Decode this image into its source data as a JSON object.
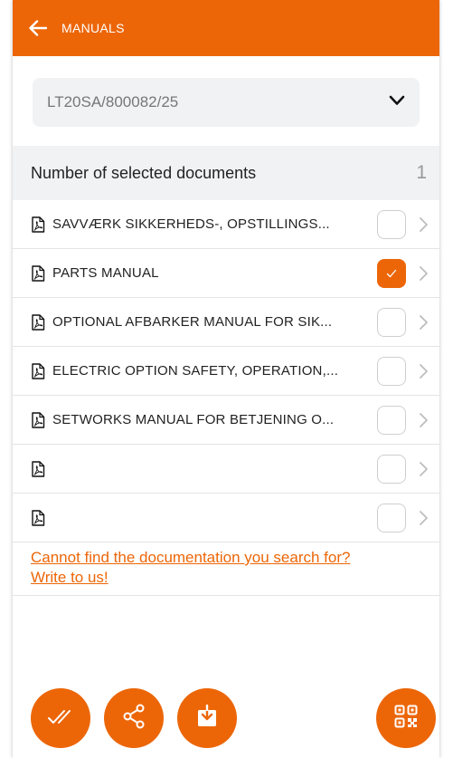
{
  "header": {
    "title": "MANUALS",
    "back_icon": "arrow-left-icon"
  },
  "machine_select": {
    "value": "LT20SA/800082/25",
    "icon": "chevron-down-icon"
  },
  "selection": {
    "label": "Number of selected documents",
    "count": "1"
  },
  "documents": [
    {
      "name": "SAVVÆRK SIKKERHEDS-, OPSTILLINGS...",
      "selected": false
    },
    {
      "name": "PARTS MANUAL",
      "selected": true
    },
    {
      "name": "OPTIONAL AFBARKER MANUAL FOR SIK...",
      "selected": false
    },
    {
      "name": "ELECTRIC OPTION SAFETY, OPERATION,...",
      "selected": false
    },
    {
      "name": "SETWORKS MANUAL FOR BETJENING O...",
      "selected": false
    },
    {
      "name": "",
      "selected": false
    },
    {
      "name": "",
      "selected": false
    }
  ],
  "help": {
    "line1": "Cannot find the documentation you search for?",
    "line2": "Write to us!"
  },
  "actions": {
    "select_all_icon": "double-check-icon",
    "share_icon": "share-icon",
    "download_icon": "download-icon",
    "qr_icon": "qr-code-icon"
  },
  "colors": {
    "accent": "#ec6608",
    "panel": "#f1f2f4"
  }
}
